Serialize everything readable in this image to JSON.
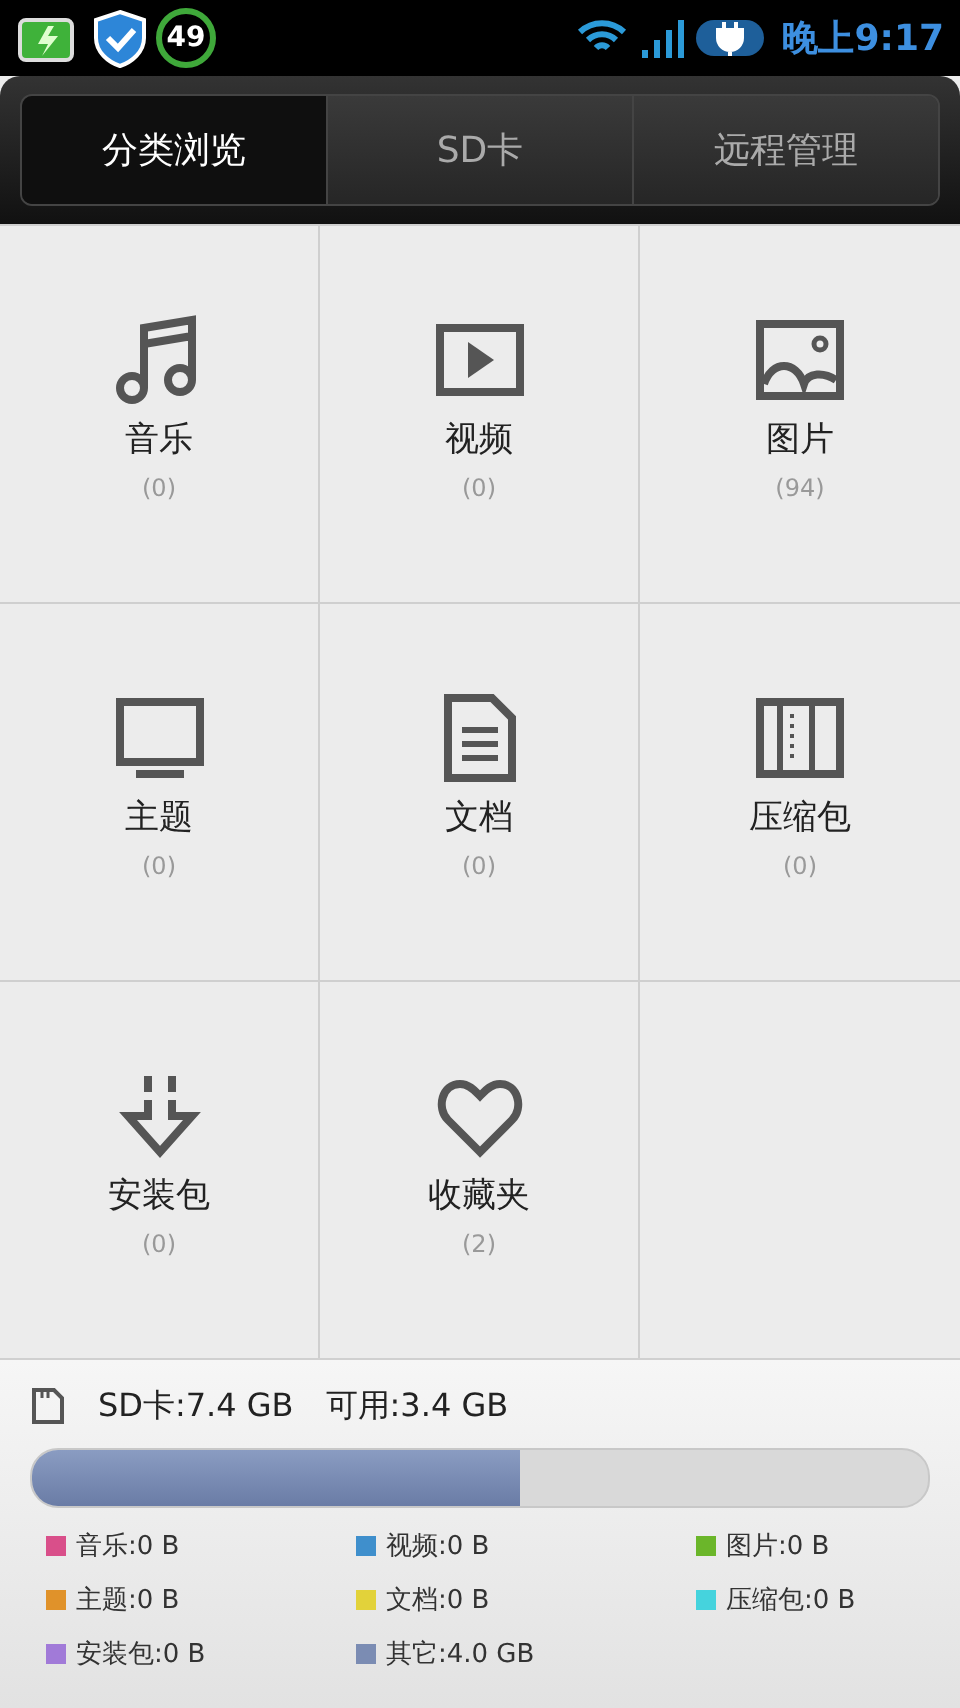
{
  "status_bar": {
    "badge": "49",
    "time": "晚上9:17"
  },
  "tabs": [
    {
      "label": "分类浏览",
      "selected": true
    },
    {
      "label": "SD卡",
      "selected": false
    },
    {
      "label": "远程管理",
      "selected": false
    }
  ],
  "categories": [
    {
      "kind": "music",
      "label": "音乐",
      "count": "(0)"
    },
    {
      "kind": "video",
      "label": "视频",
      "count": "(0)"
    },
    {
      "kind": "image",
      "label": "图片",
      "count": "(94)"
    },
    {
      "kind": "theme",
      "label": "主题",
      "count": "(0)"
    },
    {
      "kind": "document",
      "label": "文档",
      "count": "(0)"
    },
    {
      "kind": "archive",
      "label": "压缩包",
      "count": "(0)"
    },
    {
      "kind": "apk",
      "label": "安装包",
      "count": "(0)"
    },
    {
      "kind": "favorite",
      "label": "收藏夹",
      "count": "(2)"
    }
  ],
  "storage": {
    "total": "SD卡:7.4 GB",
    "free": "可用:3.4 GB",
    "level": 0.544,
    "legend": [
      {
        "label": "音乐:0 B",
        "color": "#d94f8a"
      },
      {
        "label": "视频:0 B",
        "color": "#3f8fcc"
      },
      {
        "label": "图片:0 B",
        "color": "#6bb62a"
      },
      {
        "label": "主题:0 B",
        "color": "#e0922a"
      },
      {
        "label": "文档:0 B",
        "color": "#e2d23a"
      },
      {
        "label": "压缩包:0 B",
        "color": "#45d3dd"
      },
      {
        "label": "安装包:0 B",
        "color": "#a17ad8"
      },
      {
        "label": "其它:4.0 GB",
        "color": "#7b8cb3"
      }
    ]
  }
}
